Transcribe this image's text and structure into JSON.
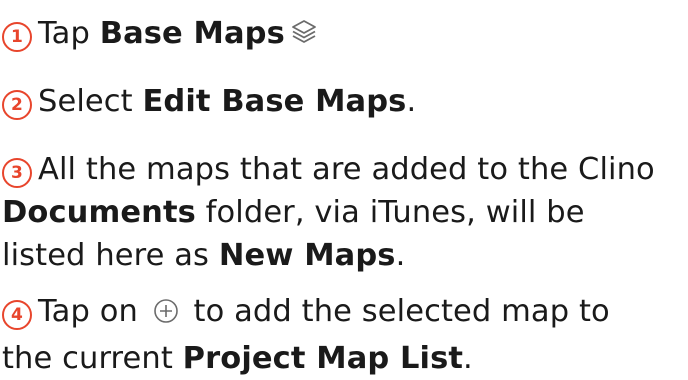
{
  "steps": [
    {
      "number": "1",
      "parts": {
        "a": "Tap ",
        "b": "Base Maps"
      },
      "icon": "layers-icon"
    },
    {
      "number": "2",
      "parts": {
        "a": "Select ",
        "b": "Edit Base Maps",
        "c": "."
      }
    },
    {
      "number": "3",
      "parts": {
        "a": "All the maps that are added to the Clino",
        "b": "Documents",
        "c": " folder, via iTunes, will be",
        "d": "listed here as ",
        "e": "New Maps",
        "f": "."
      }
    },
    {
      "number": "4",
      "parts": {
        "a": "Tap on ",
        "b": " to add the selected map to",
        "c": "the current ",
        "d": "Project Map List",
        "e": "."
      },
      "icon": "plus-circle-icon"
    }
  ],
  "colors": {
    "accent": "#e8452c",
    "text": "#1a1a1a",
    "icon": "#6b6b6b"
  }
}
